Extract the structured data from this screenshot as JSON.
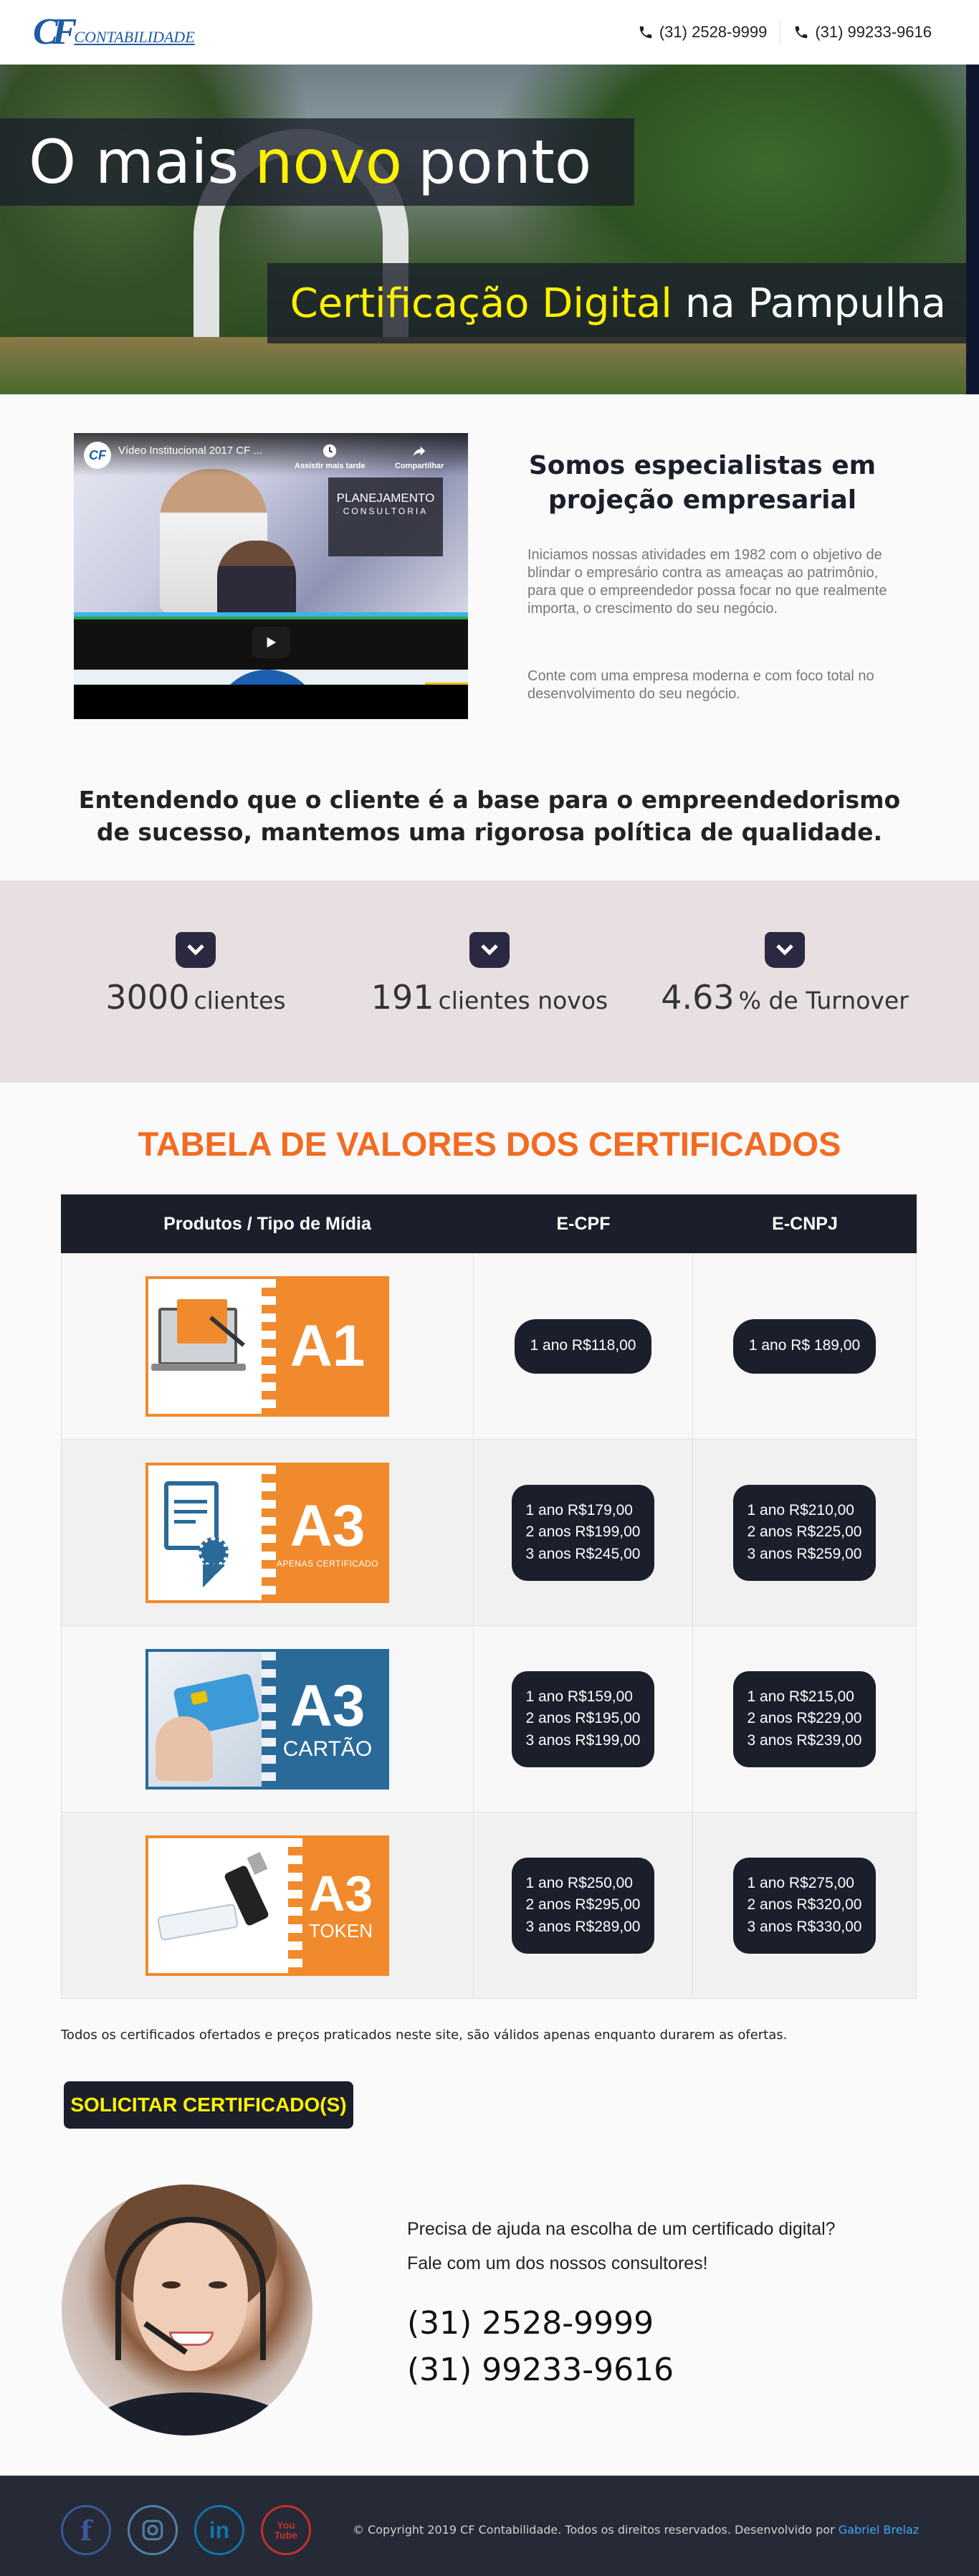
{
  "header": {
    "logo_mark": "CF",
    "logo_text": "CONTABILIDADE",
    "phones": [
      "(31) 2528-9999",
      "(31) 99233-9616"
    ]
  },
  "hero": {
    "title_pre": "O mais",
    "title_highlight": "novo",
    "title_post": "ponto",
    "sub_highlight": "Certificação Digital",
    "sub_post": "na Pampulha"
  },
  "video": {
    "logo": "CF",
    "title": "Vídeo Institucional 2017 CF ...",
    "watch_later": "Assistir mais tarde",
    "share": "Compartilhar",
    "planning": "PLANEJAMENTO",
    "consulting": "CONSULTORIA"
  },
  "intro": {
    "title": "Somos especialistas em projeção empresarial",
    "p1": "Iniciamos nossas atividades em 1982 com o objetivo de blindar o empresário contra as ameaças ao patrimônio, para que o empreendedor possa focar no que realmente importa, o crescimento do seu negócio.",
    "p2": "Conte com uma empresa moderna e com foco total no desenvolvimento do seu negócio."
  },
  "statement": "Entendendo que o cliente é a base para o empreendedorismo de sucesso, mantemos uma rigorosa política de qualidade.",
  "stats": [
    {
      "number": "3000",
      "label": "clientes",
      "icon": "chevron-down-icon"
    },
    {
      "number": "191",
      "label": "clientes novos",
      "icon": "chevron-down-icon"
    },
    {
      "number": "4.63",
      "label": "% de Turnover",
      "icon": "chevron-down-icon"
    }
  ],
  "table": {
    "title": "TABELA DE VALORES DOS CERTIFICADOS",
    "headers": [
      "Produtos / Tipo de Mídia",
      "E-CPF",
      "E-CNPJ"
    ],
    "rows": [
      {
        "product": {
          "code": "A1",
          "subtitle": ""
        },
        "ecpf": [
          "1 ano R$118,00"
        ],
        "ecnpj": [
          "1 ano R$ 189,00"
        ]
      },
      {
        "product": {
          "code": "A3",
          "subtitle": "APENAS CERTIFICADO"
        },
        "ecpf": [
          "1 ano R$179,00",
          "2 anos R$199,00",
          "3 anos R$245,00"
        ],
        "ecnpj": [
          "1 ano R$210,00",
          "2 anos R$225,00",
          "3 anos R$259,00"
        ]
      },
      {
        "product": {
          "code": "A3",
          "subtitle": "CARTÃO"
        },
        "ecpf": [
          "1 ano R$159,00",
          "2 anos R$195,00",
          "3 anos R$199,00"
        ],
        "ecnpj": [
          "1 ano R$215,00",
          "2 anos R$229,00",
          "3 anos R$239,00"
        ]
      },
      {
        "product": {
          "code": "A3",
          "subtitle": "TOKEN"
        },
        "ecpf": [
          "1 ano R$250,00",
          "2 anos R$295,00",
          "3 anos R$289,00"
        ],
        "ecnpj": [
          "1 ano R$275,00",
          "2 anos R$320,00",
          "3 anos R$330,00"
        ]
      }
    ]
  },
  "note": "Todos os certificados ofertados e preços praticados neste site, são válidos apenas enquanto durarem as ofertas.",
  "cta_label": "SOLICITAR CERTIFICADO(S)",
  "support": {
    "line1": "Precisa de ajuda na escolha de um certificado digital?",
    "line2": "Fale com um dos nossos consultores!",
    "phone1": "(31) 2528-9999",
    "phone2": "(31) 99233-9616"
  },
  "footer": {
    "social": [
      {
        "name": "facebook-icon",
        "glyph": "f",
        "color": "#3b5998"
      },
      {
        "name": "instagram-icon",
        "glyph": "◎",
        "color": "#517fa4"
      },
      {
        "name": "linkedin-icon",
        "glyph": "in",
        "color": "#0e76a8"
      },
      {
        "name": "youtube-icon",
        "glyph": "You Tube",
        "color": "#c4302b"
      }
    ],
    "copyright": "© Copyright 2019 CF Contabilidade. Todos os direitos reservados. Desenvolvido por",
    "developer": "Gabriel Brelaz"
  },
  "colors": {
    "accent": "#f36b21",
    "dark": "#1b1f2c",
    "highlight": "#fff200",
    "link": "#3da9f5"
  }
}
